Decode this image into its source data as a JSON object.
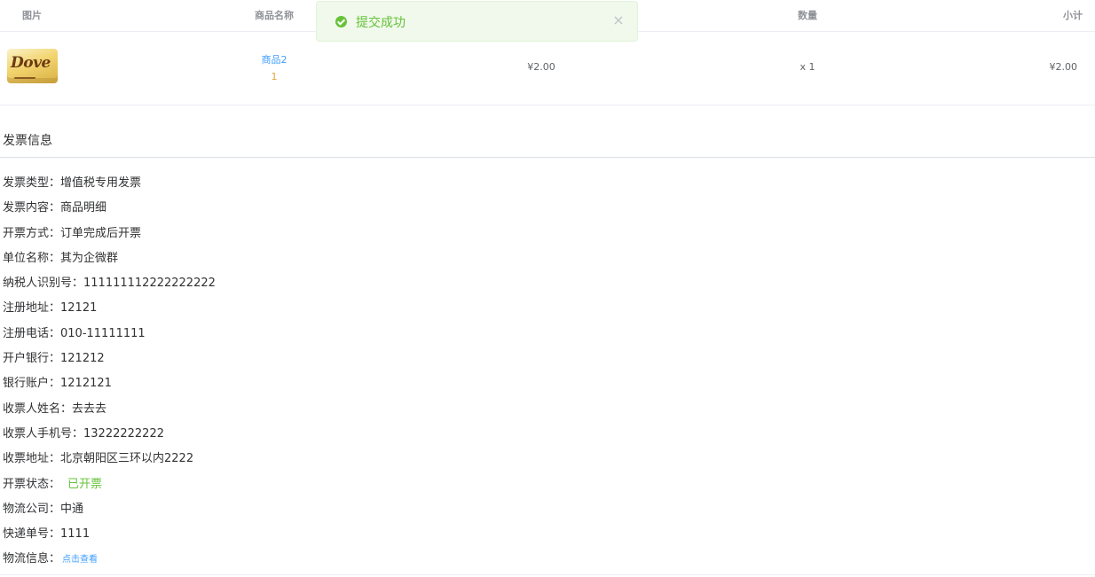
{
  "table": {
    "headers": {
      "image": "图片",
      "name": "商品名称",
      "price": "",
      "quantity": "数量",
      "subtotal": "小计"
    },
    "rows": [
      {
        "image_icon": "dove-chocolate-product-image",
        "image_text": "Dove",
        "name": "商品2",
        "number": "1",
        "price": "¥2.00",
        "quantity": "x 1",
        "subtotal": "¥2.00"
      }
    ]
  },
  "toast": {
    "icon": "success-check-icon",
    "text": "提交成功",
    "close_icon": "close-icon",
    "close_glyph": "×",
    "color": "#67c23a"
  },
  "invoice": {
    "title": "发票信息",
    "fields": [
      {
        "label": "发票类型：",
        "value": "增值税专用发票"
      },
      {
        "label": "发票内容：",
        "value": "商品明细"
      },
      {
        "label": "开票方式：",
        "value": "订单完成后开票"
      },
      {
        "label": "单位名称：",
        "value": "其为企微群"
      },
      {
        "label": "纳税人识别号：",
        "value": "111111112222222222"
      },
      {
        "label": "注册地址：",
        "value": "12121"
      },
      {
        "label": "注册电话：",
        "value": "010-11111111"
      },
      {
        "label": "开户银行：",
        "value": "121212"
      },
      {
        "label": "银行账户：",
        "value": "1212121"
      },
      {
        "label": "收票人姓名：",
        "value": "去去去"
      },
      {
        "label": "收票人手机号：",
        "value": "13222222222"
      },
      {
        "label": "收票地址：",
        "value": "北京朝阳区三环以内2222"
      },
      {
        "label": "开票状态：",
        "value": "已开票"
      },
      {
        "label": "物流公司：",
        "value": "中通"
      },
      {
        "label": "快递单号：",
        "value": "1111"
      },
      {
        "label": "物流信息：",
        "value": "点击查看"
      }
    ]
  }
}
